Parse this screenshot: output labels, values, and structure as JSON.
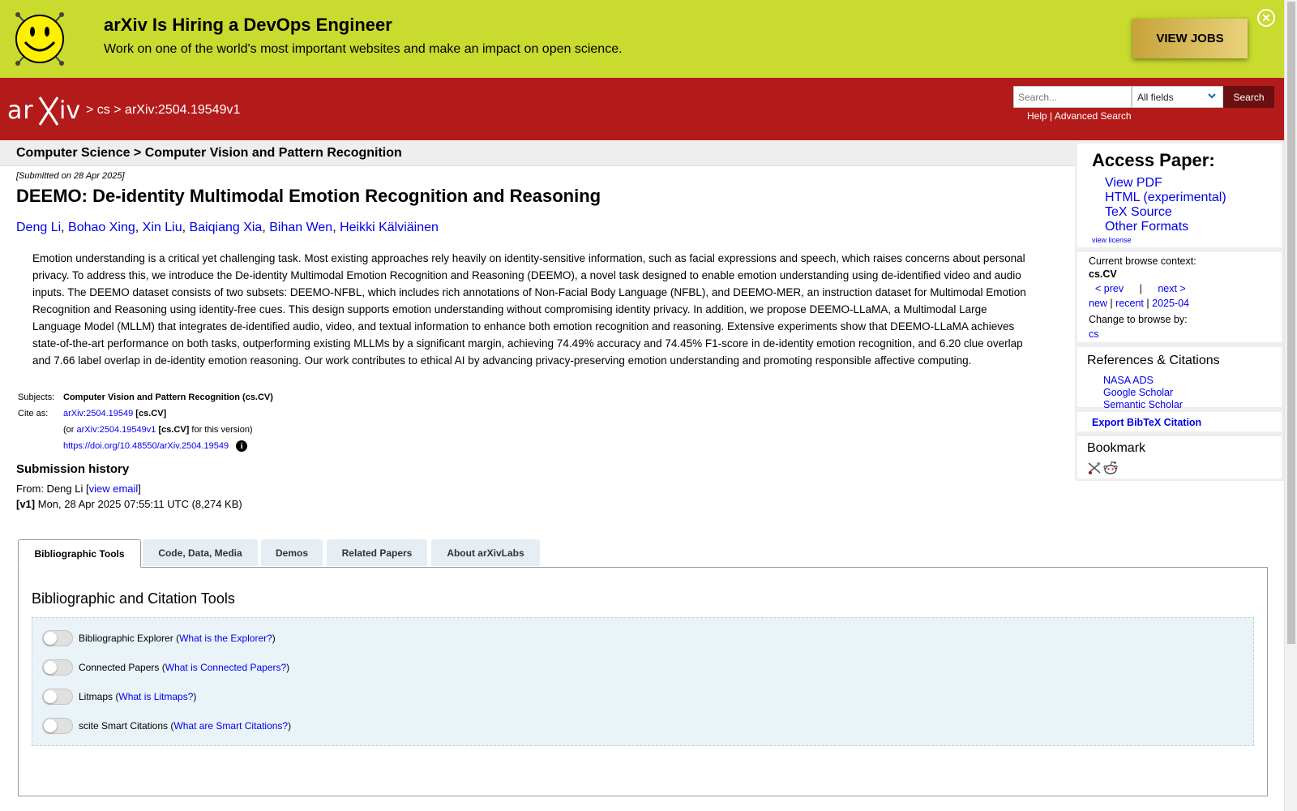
{
  "banner": {
    "title": "arXiv Is Hiring a DevOps Engineer",
    "text": "Work on one of the world's most important websites and make an impact on open science.",
    "button": "VIEW JOBS"
  },
  "header": {
    "breadcrumb_sep1": ">",
    "breadcrumb_cs": "cs",
    "breadcrumb_sep2": ">",
    "breadcrumb_id": "arXiv:2504.19549v1",
    "search_placeholder": "Search...",
    "search_field": "All fields",
    "search_button": "Search",
    "help": "Help",
    "help_sep": "|",
    "advanced": "Advanced Search"
  },
  "subheader": "Computer Science > Computer Vision and Pattern Recognition",
  "paper": {
    "submitted": "[Submitted on 28 Apr 2025]",
    "title": "DEEMO: De-identity Multimodal Emotion Recognition and Reasoning",
    "authors": [
      "Deng Li",
      "Bohao Xing",
      "Xin Liu",
      "Baiqiang Xia",
      "Bihan Wen",
      "Heikki Kälviäinen"
    ],
    "abstract": "Emotion understanding is a critical yet challenging task. Most existing approaches rely heavily on identity-sensitive information, such as facial expressions and speech, which raises concerns about personal privacy. To address this, we introduce the De-identity Multimodal Emotion Recognition and Reasoning (DEEMO), a novel task designed to enable emotion understanding using de-identified video and audio inputs. The DEEMO dataset consists of two subsets: DEEMO-NFBL, which includes rich annotations of Non-Facial Body Language (NFBL), and DEEMO-MER, an instruction dataset for Multimodal Emotion Recognition and Reasoning using identity-free cues. This design supports emotion understanding without compromising identity privacy. In addition, we propose DEEMO-LLaMA, a Multimodal Large Language Model (MLLM) that integrates de-identified audio, video, and textual information to enhance both emotion recognition and reasoning. Extensive experiments show that DEEMO-LLaMA achieves state-of-the-art performance on both tasks, outperforming existing MLLMs by a significant margin, achieving 74.49% accuracy and 74.45% F1-score in de-identity emotion recognition, and 6.20 clue overlap and 7.66 label overlap in de-identity emotion reasoning. Our work contributes to ethical AI by advancing privacy-preserving emotion understanding and promoting responsible affective computing.",
    "subjects_label": "Subjects:",
    "subjects_value": "Computer Vision and Pattern Recognition (cs.CV)",
    "cite_label": "Cite as:",
    "cite_id": "arXiv:2504.19549",
    "cite_cat": "[cs.CV]",
    "cite2_prefix": "(or",
    "cite2_id": "arXiv:2504.19549v1",
    "cite2_cat": "[cs.CV]",
    "cite2_suffix": "for this version)",
    "doi": "https://doi.org/10.48550/arXiv.2504.19549",
    "info_icon": "i"
  },
  "history": {
    "title": "Submission history",
    "from_prefix": "From: Deng Li [",
    "view_email": "view email",
    "from_suffix": "]",
    "v1_label": "[v1]",
    "v1_text": "Mon, 28 Apr 2025 07:55:11 UTC (8,274 KB)"
  },
  "tabs": [
    "Bibliographic Tools",
    "Code, Data, Media",
    "Demos",
    "Related Papers",
    "About arXivLabs"
  ],
  "panel": {
    "title": "Bibliographic and Citation Tools",
    "tools": [
      {
        "label": "Bibliographic Explorer",
        "link": "What is the Explorer?"
      },
      {
        "label": "Connected Papers",
        "link": "What is Connected Papers?"
      },
      {
        "label": "Litmaps",
        "link": "What is Litmaps?"
      },
      {
        "label": "scite Smart Citations",
        "link": "What are Smart Citations?"
      }
    ]
  },
  "sidebar": {
    "access_title": "Access Paper:",
    "access_links": [
      "View PDF",
      "HTML (experimental)",
      "TeX Source",
      "Other Formats"
    ],
    "view_license": "view license",
    "ctx_label": "Current browse context:",
    "ctx_value": "cs.CV",
    "prev": "< prev",
    "ctx_sep": "|",
    "next": "next >",
    "new": "new",
    "recent": "recent",
    "month": "2025-04",
    "change_label": "Change to browse by:",
    "change_value": "cs",
    "refs_title": "References & Citations",
    "refs_links": [
      "NASA ADS",
      "Google Scholar",
      "Semantic Scholar"
    ],
    "export": "Export BibTeX Citation",
    "bookmark_title": "Bookmark"
  },
  "colors": {
    "banner": "#c8db2e",
    "header": "#b31b1b",
    "link": "#0000ee"
  }
}
